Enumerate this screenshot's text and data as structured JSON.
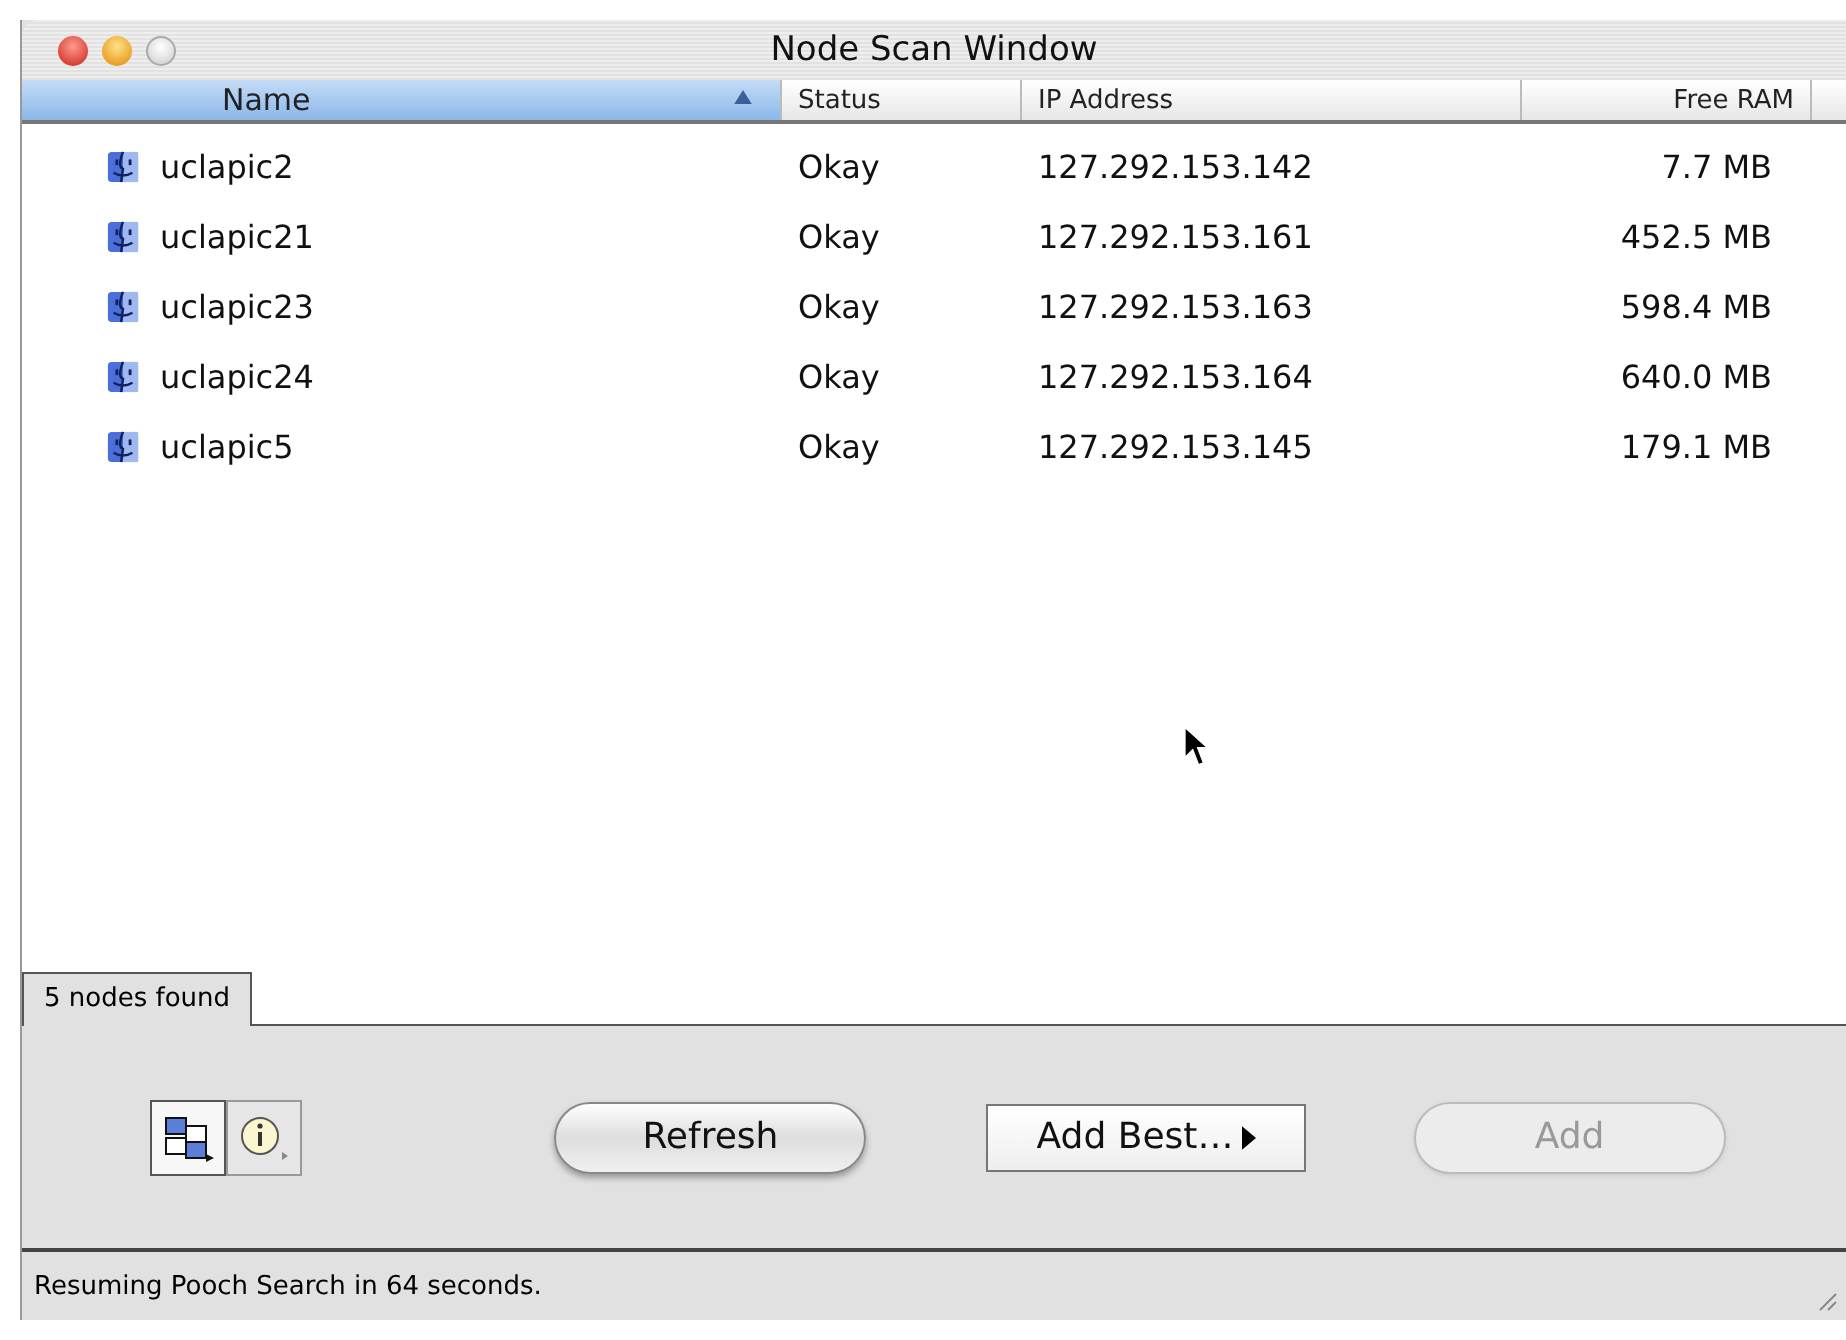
{
  "window": {
    "title": "Node Scan Window"
  },
  "table": {
    "columns": [
      {
        "label": "Name",
        "selected": true
      },
      {
        "label": "Status",
        "selected": false
      },
      {
        "label": "IP Address",
        "selected": false
      },
      {
        "label": "Free RAM",
        "selected": false
      }
    ],
    "rows": [
      {
        "name": "uclapic2",
        "status": "Okay",
        "ip": "127.292.153.142",
        "ram": "7.7 MB"
      },
      {
        "name": "uclapic21",
        "status": "Okay",
        "ip": "127.292.153.161",
        "ram": "452.5 MB"
      },
      {
        "name": "uclapic23",
        "status": "Okay",
        "ip": "127.292.153.163",
        "ram": "598.4 MB"
      },
      {
        "name": "uclapic24",
        "status": "Okay",
        "ip": "127.292.153.164",
        "ram": "640.0 MB"
      },
      {
        "name": "uclapic5",
        "status": "Okay",
        "ip": "127.292.153.145",
        "ram": "179.1 MB"
      }
    ]
  },
  "count_tab": "5 nodes found",
  "view_buttons": [
    {
      "kind": "nodes",
      "selected": true
    },
    {
      "kind": "info",
      "selected": false
    }
  ],
  "buttons": [
    {
      "label": "Refresh",
      "kind": "pill",
      "disabled": false
    },
    {
      "label": "Add Best…",
      "kind": "popup",
      "disabled": false
    },
    {
      "label": "Add",
      "kind": "pill",
      "disabled": true
    }
  ],
  "status_bar": "Resuming Pooch Search in 64 seconds."
}
